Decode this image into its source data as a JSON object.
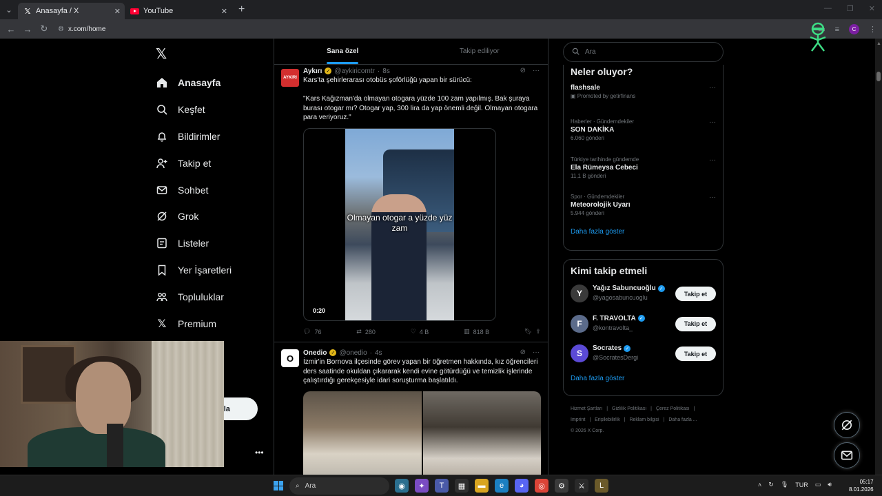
{
  "browser": {
    "tabs": [
      {
        "title": "Anasayfa / X",
        "active": true
      },
      {
        "title": "YouTube",
        "active": false
      }
    ],
    "url": "x.com/home",
    "profile_initial": "C"
  },
  "nav": {
    "items": [
      {
        "label": "Anasayfa",
        "icon": "home-icon"
      },
      {
        "label": "Keşfet",
        "icon": "search-icon"
      },
      {
        "label": "Bildirimler",
        "icon": "bell-icon"
      },
      {
        "label": "Takip et",
        "icon": "add-user-icon"
      },
      {
        "label": "Sohbet",
        "icon": "mail-icon"
      },
      {
        "label": "Grok",
        "icon": "grok-icon"
      },
      {
        "label": "Listeler",
        "icon": "list-icon"
      },
      {
        "label": "Yer İşaretleri",
        "icon": "bookmark-icon"
      },
      {
        "label": "Topluluklar",
        "icon": "communities-icon"
      },
      {
        "label": "Premium",
        "icon": "x-icon"
      }
    ],
    "post_button_partial": "nla"
  },
  "feed": {
    "tabs": [
      "Sana özel",
      "Takip ediliyor"
    ],
    "posts": [
      {
        "name": "Aykırı",
        "handle": "@aykiricomtr",
        "time": "8s",
        "avatar_text": "AYKIRI",
        "text": "Kars'ta şehirlerarası otobüs şoförlüğü yapan bir sürücü:\n\n\"Kars Kağızman'da olmayan otogara yüzde 100 zam yapılmış. Bak şuraya burası otogar mı? Otogar yap, 300 lira da yap önemli değil. Olmayan otogara para veriyoruz.\"",
        "video_caption": "Olmayan otogar a yüzde yüz zam",
        "video_time": "0:20",
        "replies": "76",
        "reposts": "280",
        "likes": "4 B",
        "views": "818 B"
      },
      {
        "name": "Onedio",
        "handle": "@onedio",
        "time": "4s",
        "avatar_text": "O",
        "text": "İzmir'in Bornova ilçesinde görev yapan bir öğretmen hakkında, kız öğrencileri ders saatinde okuldan çıkararak kendi evine götürdüğü ve temizlik işlerinde çalıştırdığı gerekçesiyle idari soruşturma başlatıldı."
      }
    ]
  },
  "sidebar": {
    "search_placeholder": "Ara",
    "trends_title": "Neler oluyor?",
    "trends": [
      {
        "meta": "",
        "name": "flashsale",
        "count": "Promoted by getirfinans"
      },
      {
        "meta": "Haberler · Gündemdekiler",
        "name": "SON DAKİKA",
        "count": "6.060 gönderi"
      },
      {
        "meta": "Türkiye tarihinde gündemde",
        "name": "Ela Rümeysa Cebeci",
        "count": "11,1 B gönderi"
      },
      {
        "meta": "Spor · Gündemdekiler",
        "name": "Meteorolojik Uyarı",
        "count": "5.944 gönderi"
      }
    ],
    "show_more": "Daha fazla göster",
    "who_title": "Kimi takip etmeli",
    "who": [
      {
        "name": "Yağız Sabuncuoğlu",
        "handle": "@yagosabuncuoglu",
        "avatar": "Y",
        "color": "#3a3a3a"
      },
      {
        "name": "F. TRAVOLTA",
        "handle": "@kontravolta_",
        "avatar": "F",
        "color": "#5b6b8a"
      },
      {
        "name": "Socrates",
        "handle": "@SocratesDergi",
        "avatar": "S",
        "color": "#5b4ad6"
      }
    ],
    "follow_label": "Takip et",
    "footer": [
      "Hizmet Şartları",
      "|",
      "Gizlilik Politikası",
      "|",
      "Çerez Politikası",
      "|",
      "Imprint",
      "|",
      "Erişilebilirlik",
      "|",
      "Reklam bilgisi",
      "|",
      "Daha fazla ...",
      "© 2026 X Corp."
    ]
  },
  "taskbar": {
    "search": "Ara",
    "lang": "TUR",
    "time": "05:17",
    "date": "8.01.2026"
  }
}
